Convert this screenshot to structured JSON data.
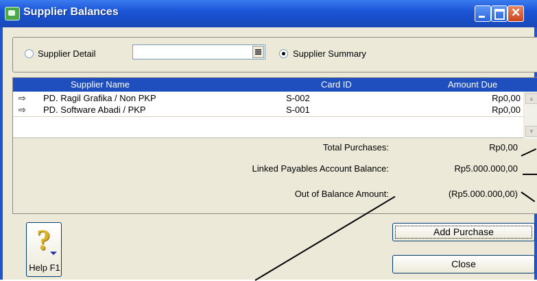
{
  "window": {
    "title": "Supplier Balances"
  },
  "filter": {
    "supplier_detail_label": "Supplier Detail",
    "supplier_detail_checked": false,
    "supplier_combo_value": "",
    "supplier_summary_label": "Supplier Summary",
    "supplier_summary_checked": true
  },
  "grid": {
    "headers": {
      "name": "Supplier Name",
      "card_id": "Card ID",
      "amount_due": "Amount Due"
    },
    "rows": [
      {
        "name": "PD. Ragil Grafika / Non PKP",
        "card_id": "S-002",
        "amount_due": "Rp0,00"
      },
      {
        "name": "PD. Software Abadi / PKP",
        "card_id": "S-001",
        "amount_due": "Rp0,00"
      }
    ]
  },
  "totals": {
    "total_purchases_label": "Total Purchases:",
    "total_purchases_value": "Rp0,00",
    "linked_payables_label": "Linked Payables Account Balance:",
    "linked_payables_value": "Rp5.000.000,00",
    "out_of_balance_label": "Out of Balance Amount:",
    "out_of_balance_value": "(Rp5.000.000,00)"
  },
  "buttons": {
    "help_label": "Help F1",
    "add_purchase_label": "Add Purchase",
    "close_label": "Close"
  },
  "colors": {
    "title_bar": "#1a55d6",
    "grid_header": "#1f4fbf",
    "client_bg": "#ece9d8"
  }
}
